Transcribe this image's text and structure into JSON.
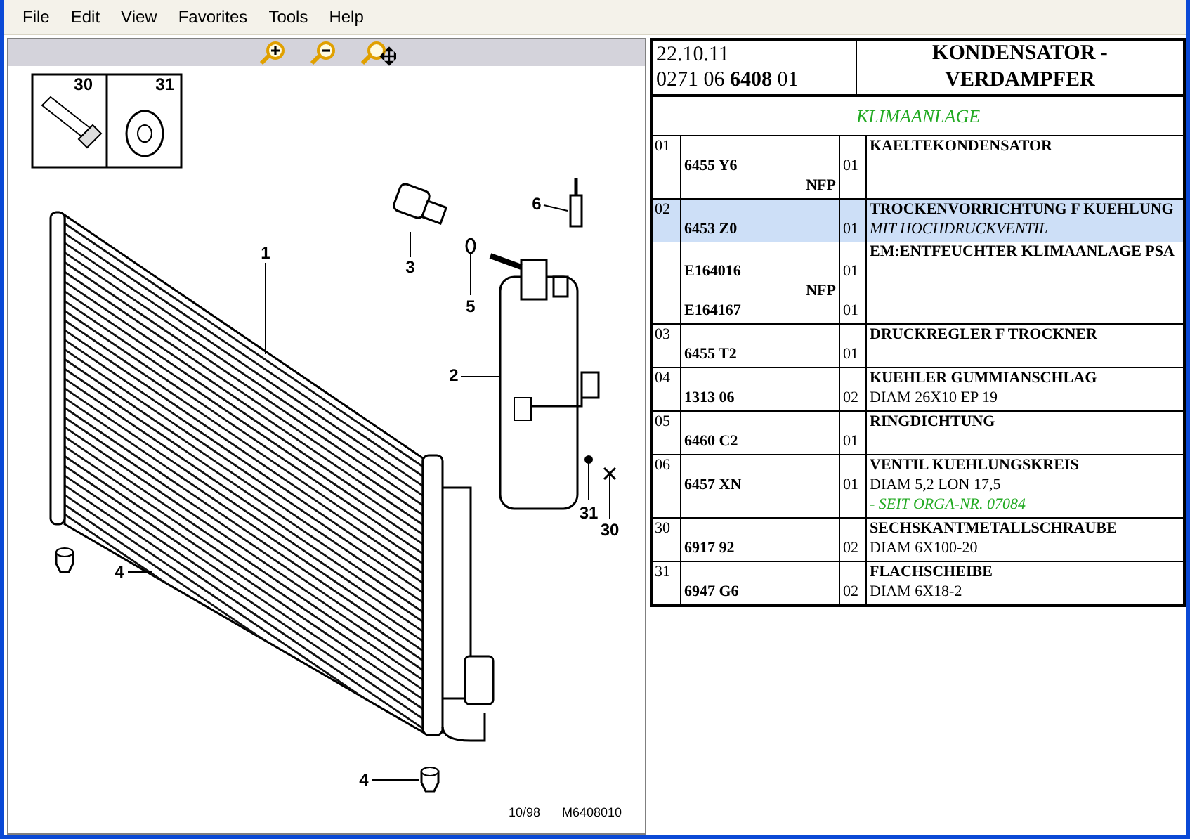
{
  "menu": [
    "File",
    "Edit",
    "View",
    "Favorites",
    "Tools",
    "Help"
  ],
  "diagram": {
    "inset_labels": [
      "30",
      "31"
    ],
    "callouts": [
      "1",
      "2",
      "3",
      "4",
      "4",
      "5",
      "6",
      "31",
      "30"
    ],
    "footer": [
      "10/98",
      "M6408010"
    ]
  },
  "header": {
    "date": "22.10.11",
    "reference": "0271 06 **6408** 01",
    "title": "KONDENSATOR - VERDAMPFER"
  },
  "section": "KLIMAANLAGE",
  "rows": [
    {
      "index": "01",
      "selected": false,
      "parts": [
        {
          "number": "6455 Y6",
          "qty": "01",
          "nfp": "NFP"
        }
      ],
      "lines": [
        {
          "kind": "title",
          "text": "KAELTEKONDENSATOR"
        }
      ]
    },
    {
      "index": "02",
      "selected": true,
      "parts": [
        {
          "number": "6453 Z0",
          "qty": "01"
        }
      ],
      "lines": [
        {
          "kind": "title",
          "text": "TROCKENVORRICHTUNG F KUEHLUNG"
        },
        {
          "kind": "variant",
          "text": "MIT HOCHDRUCKVENTIL"
        }
      ]
    },
    {
      "selected": false,
      "parts": [
        {
          "number": "E164016",
          "qty": "01",
          "nfp": "NFP"
        },
        {
          "number": "E164167",
          "qty": "01"
        }
      ],
      "lines": [
        {
          "kind": "title",
          "text": "EM:ENTFEUCHTER KLIMAANLAGE PSA"
        }
      ]
    },
    {
      "index": "03",
      "selected": false,
      "parts": [
        {
          "number": "6455 T2",
          "qty": "01"
        }
      ],
      "lines": [
        {
          "kind": "title",
          "text": "DRUCKREGLER F TROCKNER"
        }
      ]
    },
    {
      "index": "04",
      "selected": false,
      "parts": [
        {
          "number": "1313 06",
          "qty": "02"
        }
      ],
      "lines": [
        {
          "kind": "title",
          "text": "KUEHLER GUMMIANSCHLAG"
        },
        {
          "kind": "detail",
          "text": "DIAM 26X10 EP 19"
        }
      ]
    },
    {
      "index": "05",
      "selected": false,
      "parts": [
        {
          "number": "6460 C2",
          "qty": "01"
        }
      ],
      "lines": [
        {
          "kind": "title",
          "text": "RINGDICHTUNG"
        }
      ]
    },
    {
      "index": "06",
      "selected": false,
      "parts": [
        {
          "number": "6457 XN",
          "qty": "01"
        }
      ],
      "lines": [
        {
          "kind": "title",
          "text": "VENTIL KUEHLUNGSKREIS"
        },
        {
          "kind": "detail",
          "text": "DIAM 5,2 LON 17,5"
        },
        {
          "kind": "note",
          "text": "- SEIT ORGA-NR. 07084"
        }
      ]
    },
    {
      "index": "30",
      "selected": false,
      "parts": [
        {
          "number": "6917 92",
          "qty": "02"
        }
      ],
      "lines": [
        {
          "kind": "title",
          "text": "SECHSKANTMETALLSCHRAUBE"
        },
        {
          "kind": "detail",
          "text": "DIAM 6X100-20"
        }
      ]
    },
    {
      "index": "31",
      "selected": false,
      "parts": [
        {
          "number": "6947 G6",
          "qty": "02"
        }
      ],
      "lines": [
        {
          "kind": "title",
          "text": "FLACHSCHEIBE"
        },
        {
          "kind": "detail",
          "text": "DIAM 6X18-2"
        }
      ]
    }
  ]
}
